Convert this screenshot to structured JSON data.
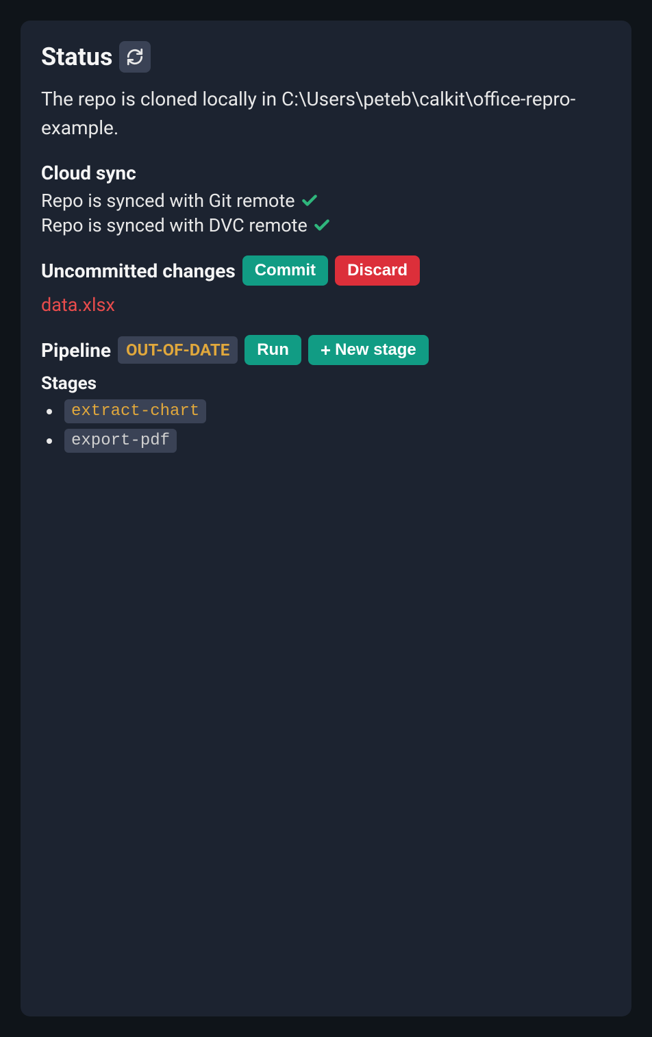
{
  "status": {
    "title": "Status",
    "description": "The repo is cloned locally in C:\\Users\\peteb\\calkit\\office-repro-example."
  },
  "cloud_sync": {
    "title": "Cloud sync",
    "git_text": "Repo is synced with Git remote",
    "dvc_text": "Repo is synced with DVC remote"
  },
  "uncommitted": {
    "title": "Uncommitted changes",
    "commit_label": "Commit",
    "discard_label": "Discard",
    "files": [
      "data.xlsx"
    ]
  },
  "pipeline": {
    "title": "Pipeline",
    "badge": "OUT-OF-DATE",
    "run_label": "Run",
    "new_stage_label": "New stage",
    "stages_title": "Stages",
    "stages": [
      {
        "name": "extract-chart",
        "out_of_date": true
      },
      {
        "name": "export-pdf",
        "out_of_date": false
      }
    ]
  }
}
